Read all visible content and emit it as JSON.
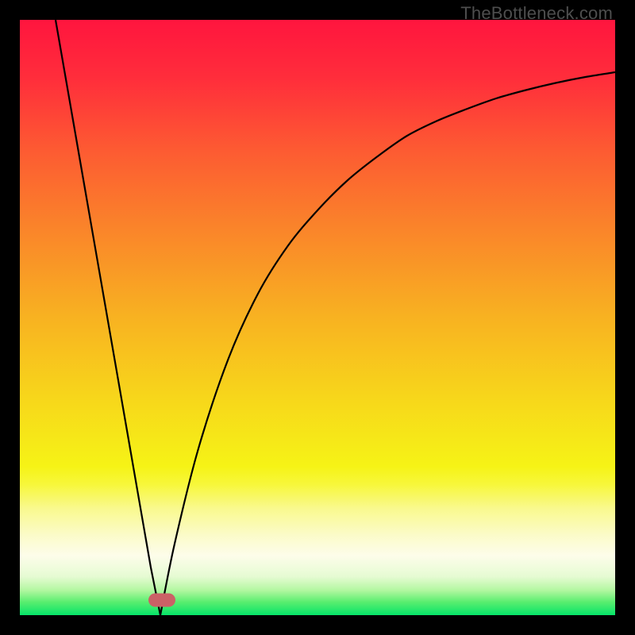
{
  "watermark": "TheBottleneck.com",
  "gradient_stops": [
    {
      "offset": 0.0,
      "color": "#ff153e"
    },
    {
      "offset": 0.1,
      "color": "#ff2e3b"
    },
    {
      "offset": 0.22,
      "color": "#fd5b32"
    },
    {
      "offset": 0.35,
      "color": "#fa842a"
    },
    {
      "offset": 0.5,
      "color": "#f8b221"
    },
    {
      "offset": 0.63,
      "color": "#f7d51b"
    },
    {
      "offset": 0.75,
      "color": "#f6f316"
    },
    {
      "offset": 0.78,
      "color": "#f7f73a"
    },
    {
      "offset": 0.82,
      "color": "#f9f98d"
    },
    {
      "offset": 0.865,
      "color": "#fbfbc8"
    },
    {
      "offset": 0.9,
      "color": "#fdfdea"
    },
    {
      "offset": 0.935,
      "color": "#e6fbd3"
    },
    {
      "offset": 0.958,
      "color": "#b3f7a1"
    },
    {
      "offset": 0.978,
      "color": "#59ee6f"
    },
    {
      "offset": 1.0,
      "color": "#06e469"
    }
  ],
  "marker": {
    "x_frac": 0.238,
    "y_frac": 0.975
  },
  "chart_data": {
    "type": "line",
    "title": "",
    "xlabel": "",
    "ylabel": "",
    "xlim": [
      0,
      100
    ],
    "ylim": [
      0,
      100
    ],
    "note": "Bottleneck-style V-curve. Minimum (optimal) near x≈23. Left branch nearly straight from top-left down to minimum; right branch rises with decreasing slope toward upper-right.",
    "series": [
      {
        "name": "left_branch",
        "x": [
          6,
          10,
          14,
          18,
          22,
          23.6
        ],
        "values": [
          100,
          77,
          54,
          31,
          8,
          0
        ]
      },
      {
        "name": "right_branch",
        "x": [
          23.6,
          26,
          30,
          35,
          40,
          45,
          50,
          55,
          60,
          65,
          70,
          75,
          80,
          85,
          90,
          95,
          100
        ],
        "values": [
          0,
          12,
          28,
          43,
          54,
          62,
          68,
          73,
          77,
          80.5,
          83,
          85,
          86.8,
          88.2,
          89.4,
          90.4,
          91.2
        ]
      }
    ]
  }
}
